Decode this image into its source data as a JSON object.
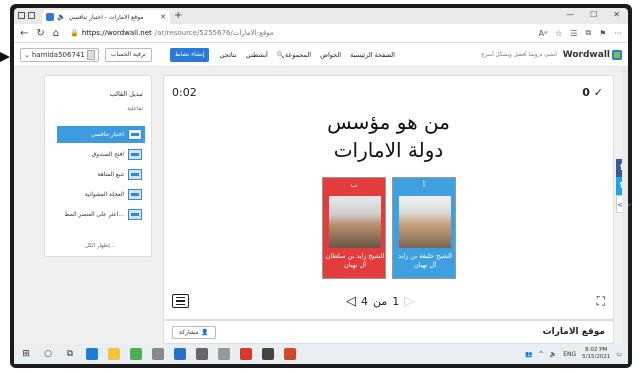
{
  "browser": {
    "tab_title": "موقع الامارات - اختبار تنافسي",
    "tab_close": "✕",
    "new_tab": "+",
    "window_controls": [
      "—",
      "☐",
      "✕"
    ],
    "url_domain": "https://wordwall.net",
    "url_path": "/ar/resource/5255676/موقع-الامارات"
  },
  "header": {
    "username": "hamida506741",
    "upgrade_label": "ترقية الحساب",
    "create_label": "إنشاء نشاط",
    "nav": [
      "نتائجي",
      "أنشطتي",
      "المجموعة",
      "الخواص",
      "الصفحة الرئيسية"
    ],
    "tagline": "أنشئ دروسًا أفضل وبشكل أسرع",
    "logo": "Wordwall"
  },
  "template_panel": {
    "title": "تبديل القالب",
    "subtitle": "تفاعلية",
    "items": [
      {
        "label": "اختبار تنافسي",
        "active": true
      },
      {
        "label": "افتح الصندوق",
        "active": false
      },
      {
        "label": "تتبع المتاهة",
        "active": false
      },
      {
        "label": "العجلة العشوائية",
        "active": false
      },
      {
        "label": "اعثر على العنصر المط...",
        "active": false
      }
    ],
    "more": "إظهار الكل..."
  },
  "activity": {
    "score": "0 ✓",
    "timer": "0:02",
    "question_line1": "من هو مؤسس",
    "question_line2": "دولة الامارات",
    "cards": [
      {
        "letter": "ب",
        "caption": "الشيخ زايد بن سلطان آل نهيان",
        "color": "#e23c3c"
      },
      {
        "letter": "أ",
        "caption": "الشيخ خليفة بن زايد آل نهيان",
        "color": "#3fa0e0"
      }
    ],
    "page_current": "1",
    "page_sep": "من",
    "page_total": "4"
  },
  "bottom": {
    "share_label": "مشاركة",
    "resource_title": "موقع الامارات"
  },
  "taskbar": {
    "lang": "ENG",
    "time": "8:02 PM",
    "date": "5/15/2021"
  }
}
